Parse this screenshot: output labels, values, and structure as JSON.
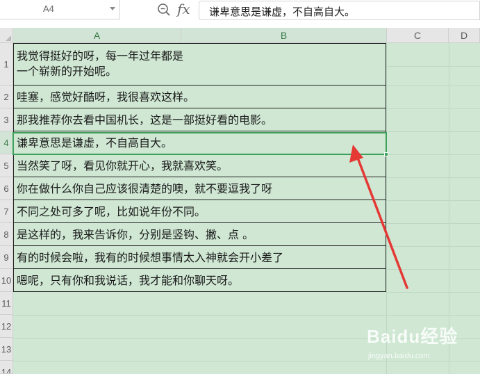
{
  "formula_bar": {
    "name_box": "A4",
    "fx_label": "fx",
    "formula": "谦卑意思是谦虚，不自高自大。"
  },
  "columns": [
    "A",
    "B",
    "C",
    "D"
  ],
  "rows": [
    {
      "num": "1",
      "text_line1": "我觉得挺好的呀，每一年过年都是",
      "text_line2": "一个崭新的开始呢。"
    },
    {
      "num": "2",
      "text_line1": "哇塞，感觉好酷呀，我很喜欢这样。"
    },
    {
      "num": "3",
      "text_line1": "那我推荐你去看中国机长，这是一部挺好看的电影。"
    },
    {
      "num": "4",
      "text_line1": "谦卑意思是谦虚，不自高自大。"
    },
    {
      "num": "5",
      "text_line1": "当然笑了呀，看见你就开心，我就喜欢笑。"
    },
    {
      "num": "6",
      "text_line1": "你在做什么你自己应该很清楚的噢，就不要逗我了呀"
    },
    {
      "num": "7",
      "text_line1": "不同之处可多了呢，比如说年份不同。"
    },
    {
      "num": "8",
      "text_line1": "是这样的，我来告诉你，分别是竖钩、撇、点 。"
    },
    {
      "num": "9",
      "text_line1": "有的时候会啦，我有的时候想事情太入神就会开小差了"
    },
    {
      "num": "10",
      "text_line1": "嗯呢，只有你和我说话，我才能和你聊天呀。"
    },
    {
      "num": "11"
    },
    {
      "num": "12"
    },
    {
      "num": "13"
    },
    {
      "num": "14"
    }
  ],
  "active_cell": "A4",
  "watermark": {
    "brand": "Baidu经验",
    "url": "jingyan.baidu.com"
  },
  "colors": {
    "sheet_bg": "#cfe7d3",
    "selection": "#3da05a",
    "arrow": "#e53935"
  }
}
